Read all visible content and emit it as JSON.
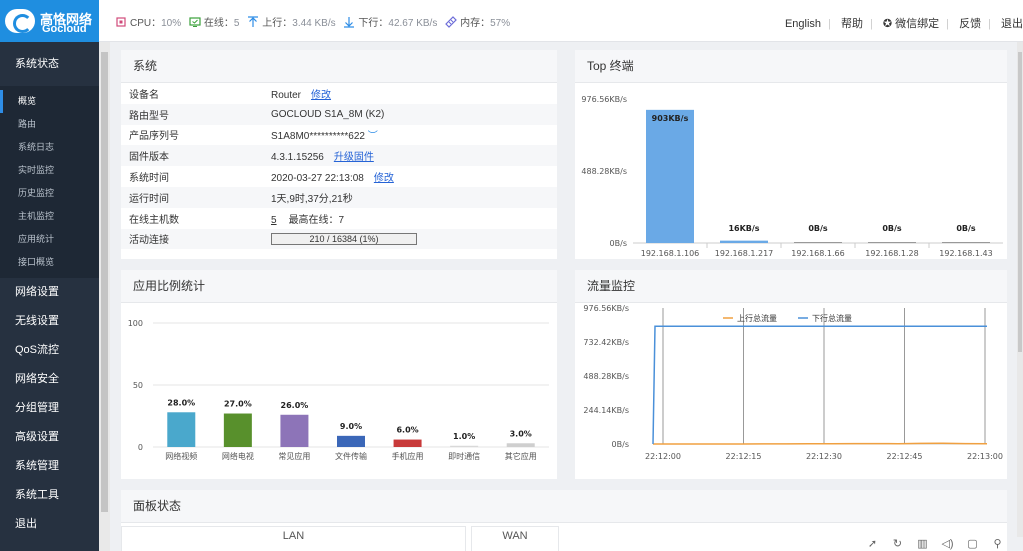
{
  "brand": {
    "cn": "高恪网络",
    "en": "Gocloud"
  },
  "status": {
    "cpu_label": "CPU：",
    "cpu_value": "10%",
    "online_label": "在线：",
    "online_value": "5",
    "up_label": "上行：",
    "up_value": "3.44 KB/s",
    "down_label": "下行：",
    "down_value": "42.67 KB/s",
    "mem_label": "内存：",
    "mem_value": "57%"
  },
  "header_links": [
    "English",
    "帮助",
    "微信绑定",
    "反馈",
    "退出"
  ],
  "sidebar": {
    "system_status": "系统状态",
    "sub_items": [
      "概览",
      "路由",
      "系统日志",
      "实时监控",
      "历史监控",
      "主机监控",
      "应用统计",
      "接口概览"
    ],
    "sections": [
      "网络设置",
      "无线设置",
      "QoS流控",
      "网络安全",
      "分组管理",
      "高级设置",
      "系统管理",
      "系统工具",
      "退出"
    ]
  },
  "system_panel": {
    "title": "系统",
    "rows": [
      {
        "key": "设备名",
        "value": "Router",
        "link": "修改"
      },
      {
        "key": "路由型号",
        "value": "GOCLOUD S1A_8M (K2)"
      },
      {
        "key": "产品序列号",
        "value": "S1A8M0**********622"
      },
      {
        "key": "固件版本",
        "value": "4.3.1.15256",
        "link": "升级固件"
      },
      {
        "key": "系统时间",
        "value": "2020-03-27 22:13:08",
        "link": "修改"
      },
      {
        "key": "运行时间",
        "value": "1天,9时,37分,21秒"
      },
      {
        "key": "在线主机数",
        "value": "5",
        "extra": "最高在线：7"
      },
      {
        "key": "活动连接",
        "value": "210 / 16384 (1%)",
        "fraction": 0.0128
      }
    ]
  },
  "top_panel": {
    "title": "Top 终端"
  },
  "app_panel": {
    "title": "应用比例统计"
  },
  "flow_panel": {
    "title": "流量监控"
  },
  "board_panel": {
    "title": "面板状态",
    "lan": "LAN",
    "wan": "WAN"
  },
  "chart_data": [
    {
      "type": "bar",
      "title": "Top 终端",
      "categories": [
        "192.168.1.106",
        "192.168.1.217",
        "192.168.1.66",
        "192.168.1.28",
        "192.168.1.43"
      ],
      "values": [
        903,
        16,
        0,
        0,
        0
      ],
      "value_labels": [
        "903KB/s",
        "16KB/s",
        "0B/s",
        "0B/s",
        "0B/s"
      ],
      "y_ticks": [
        "976.56KB/s",
        "488.28KB/s",
        "0B/s"
      ],
      "ylim": [
        0,
        976.56
      ],
      "color": "#6aa9e6"
    },
    {
      "type": "bar",
      "title": "应用比例统计",
      "categories": [
        "网络视频",
        "网络电视",
        "常见应用",
        "文件传输",
        "手机应用",
        "即时通信",
        "其它应用"
      ],
      "values": [
        28.0,
        27.0,
        26.0,
        9.0,
        6.0,
        1.0,
        3.0
      ],
      "value_labels": [
        "28.0%",
        "27.0%",
        "26.0%",
        "9.0%",
        "6.0%",
        "1.0%",
        "3.0%"
      ],
      "colors": [
        "#4aa8cc",
        "#58902c",
        "#8d74b8",
        "#3b67b8",
        "#c83a3a",
        "#d9d9d9",
        "#cfcfcf"
      ],
      "y_ticks": [
        "100",
        "50",
        "0"
      ],
      "ylim": [
        0,
        100
      ]
    },
    {
      "type": "line",
      "title": "流量监控",
      "x_ticks": [
        "22:12:00",
        "22:12:15",
        "22:12:30",
        "22:12:45",
        "22:13:00"
      ],
      "y_ticks": [
        "976.56KB/s",
        "732.42KB/s",
        "488.28KB/s",
        "244.14KB/s",
        "0B/s"
      ],
      "ylim": [
        0,
        976.56
      ],
      "series": [
        {
          "name": "上行总流量",
          "color": "#f0a040",
          "values": [
            0,
            0,
            0,
            0,
            0,
            1,
            1,
            2,
            2,
            3,
            3,
            2,
            4,
            5,
            3,
            2
          ]
        },
        {
          "name": "下行总流量",
          "color": "#4a90d9",
          "values": [
            0,
            845,
            845,
            845,
            845,
            845,
            845,
            845,
            845,
            845,
            845,
            845,
            845,
            845,
            845,
            845
          ]
        }
      ]
    }
  ]
}
